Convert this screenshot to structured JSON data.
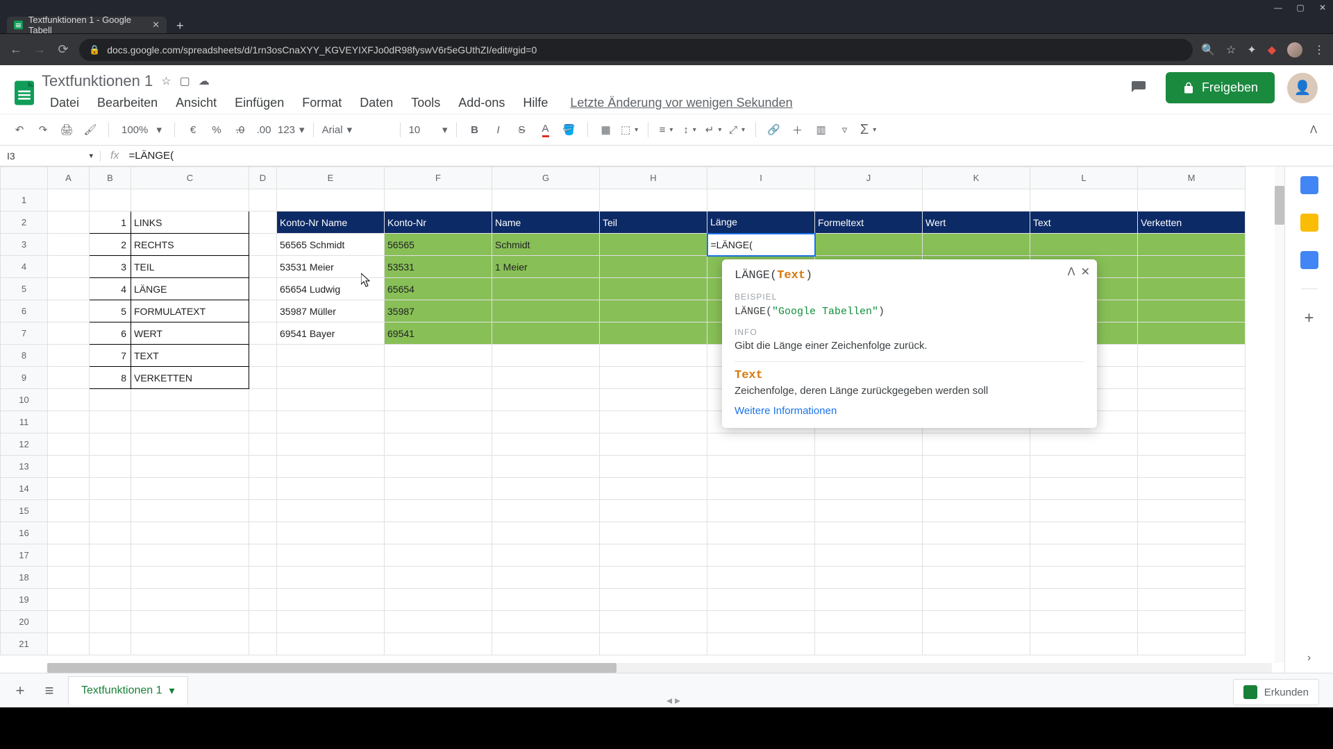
{
  "browser": {
    "tab_title": "Textfunktionen 1 - Google Tabell",
    "url": "docs.google.com/spreadsheets/d/1rn3osCnaXYY_KGVEYIXFJo0dR98fyswV6r5eGUthZI/edit#gid=0"
  },
  "doc": {
    "title": "Textfunktionen 1",
    "last_edit": "Letzte Änderung vor wenigen Sekunden",
    "share_label": "Freigeben"
  },
  "menu": {
    "file": "Datei",
    "edit": "Bearbeiten",
    "view": "Ansicht",
    "insert": "Einfügen",
    "format": "Format",
    "data": "Daten",
    "tools": "Tools",
    "addons": "Add-ons",
    "help": "Hilfe"
  },
  "toolbar": {
    "zoom": "100%",
    "num_format": "123",
    "font": "Arial",
    "font_size": "10",
    "currency": "€",
    "percent": "%",
    "dec_minus": ".0",
    "dec_plus": ".00"
  },
  "formula_bar": {
    "name_box": "I3",
    "fx": "fx",
    "formula": "=LÄNGE("
  },
  "columns": [
    "",
    "A",
    "B",
    "C",
    "D",
    "E",
    "F",
    "G",
    "H",
    "I",
    "J",
    "K",
    "L",
    "M"
  ],
  "row_numbers": [
    "1",
    "2",
    "3",
    "4",
    "5",
    "6",
    "7",
    "8",
    "9",
    "10",
    "11",
    "12",
    "13",
    "14",
    "15",
    "16",
    "17",
    "18",
    "19",
    "20",
    "21"
  ],
  "function_list": {
    "items": [
      {
        "n": "1",
        "name": "LINKS"
      },
      {
        "n": "2",
        "name": "RECHTS"
      },
      {
        "n": "3",
        "name": "TEIL"
      },
      {
        "n": "4",
        "name": "LÄNGE"
      },
      {
        "n": "5",
        "name": "FORMULATEXT"
      },
      {
        "n": "6",
        "name": "WERT"
      },
      {
        "n": "7",
        "name": "TEXT"
      },
      {
        "n": "8",
        "name": "VERKETTEN"
      }
    ]
  },
  "table_headers": {
    "konto_name": "Konto-Nr Name",
    "konto": "Konto-Nr",
    "name": "Name",
    "teil": "Teil",
    "laenge": "Länge",
    "formeltext": "Formeltext",
    "wert": "Wert",
    "text": "Text",
    "verketten": "Verketten"
  },
  "data_rows": [
    {
      "konto_name": "56565 Schmidt",
      "konto": "56565",
      "name": "Schmidt"
    },
    {
      "konto_name": "53531 Meier",
      "konto": "53531",
      "name": "1 Meier"
    },
    {
      "konto_name": "65654 Ludwig",
      "konto": "65654",
      "name": ""
    },
    {
      "konto_name": "35987 Müller",
      "konto": "35987",
      "name": ""
    },
    {
      "konto_name": "69541 Bayer",
      "konto": "69541",
      "name": ""
    }
  ],
  "editing": {
    "value": "=LÄNGE("
  },
  "formula_help": {
    "fn": "LÄNGE",
    "arg": "Text",
    "example_label": "BEISPIEL",
    "example_pre": "LÄNGE(",
    "example_str": "\"Google Tabellen\"",
    "example_post": ")",
    "info_label": "INFO",
    "info_text": "Gibt die Länge einer Zeichenfolge zurück.",
    "arg_desc": "Zeichenfolge, deren Länge zurückgegeben werden soll",
    "more_link": "Weitere Informationen"
  },
  "sheet_tab": {
    "name": "Textfunktionen 1"
  },
  "explore": {
    "label": "Erkunden"
  }
}
